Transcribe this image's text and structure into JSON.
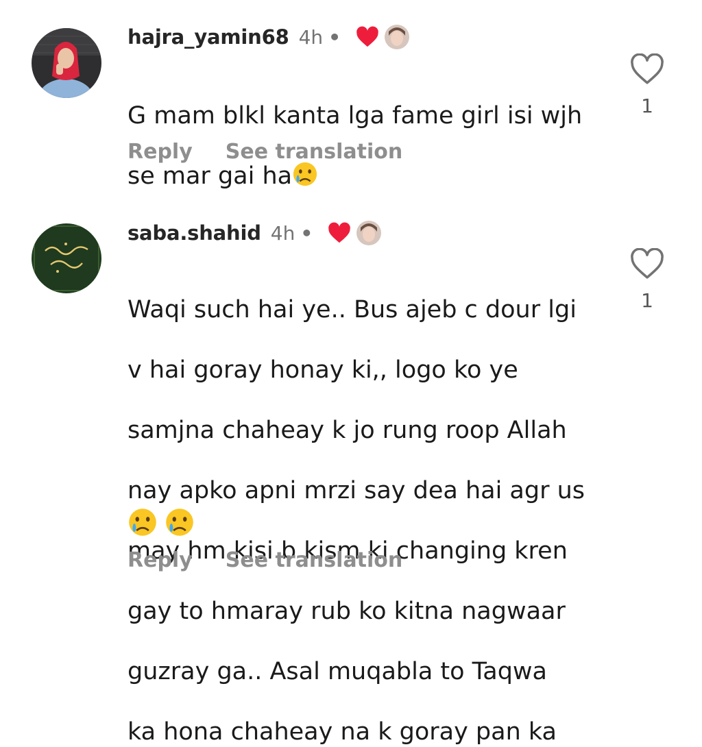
{
  "comments": [
    {
      "username": "hajra_yamin68",
      "time": "4h",
      "separator": "•",
      "text_lines": [
        "G mam blkl kanta lga fame girl isi wjh",
        "se mar gai ha"
      ],
      "trailing_emoji": [
        "crying-face"
      ],
      "like_count": "1",
      "reply_label": "Reply",
      "translate_label": "See translation",
      "author_liked": true
    },
    {
      "username": "saba.shahid",
      "time": "4h",
      "separator": "•",
      "text_lines": [
        "Waqi such hai ye.. Bus ajeb c dour lgi",
        "v hai goray honay ki,, logo ko ye",
        "samjna chaheay k jo rung roop Allah",
        "nay apko apni mrzi say dea hai agr us",
        "may hm kisi b kism ki changing kren",
        "gay to hmaray rub ko kitna nagwaar",
        "guzray ga.. Asal muqabla to Taqwa",
        "ka hona chaheay na k goray pan ka"
      ],
      "trailing_emoji": [
        "crying-face",
        "crying-face"
      ],
      "like_count": "1",
      "reply_label": "Reply",
      "translate_label": "See translation",
      "author_liked": true
    }
  ],
  "colors": {
    "author_heart": "#ee1d3c",
    "muted_text": "#8e8e8e",
    "username": "#262626"
  },
  "icons": {
    "like": "heart-outline-icon",
    "author_like": "heart-filled-icon",
    "emoji": "crying-face-emoji"
  }
}
